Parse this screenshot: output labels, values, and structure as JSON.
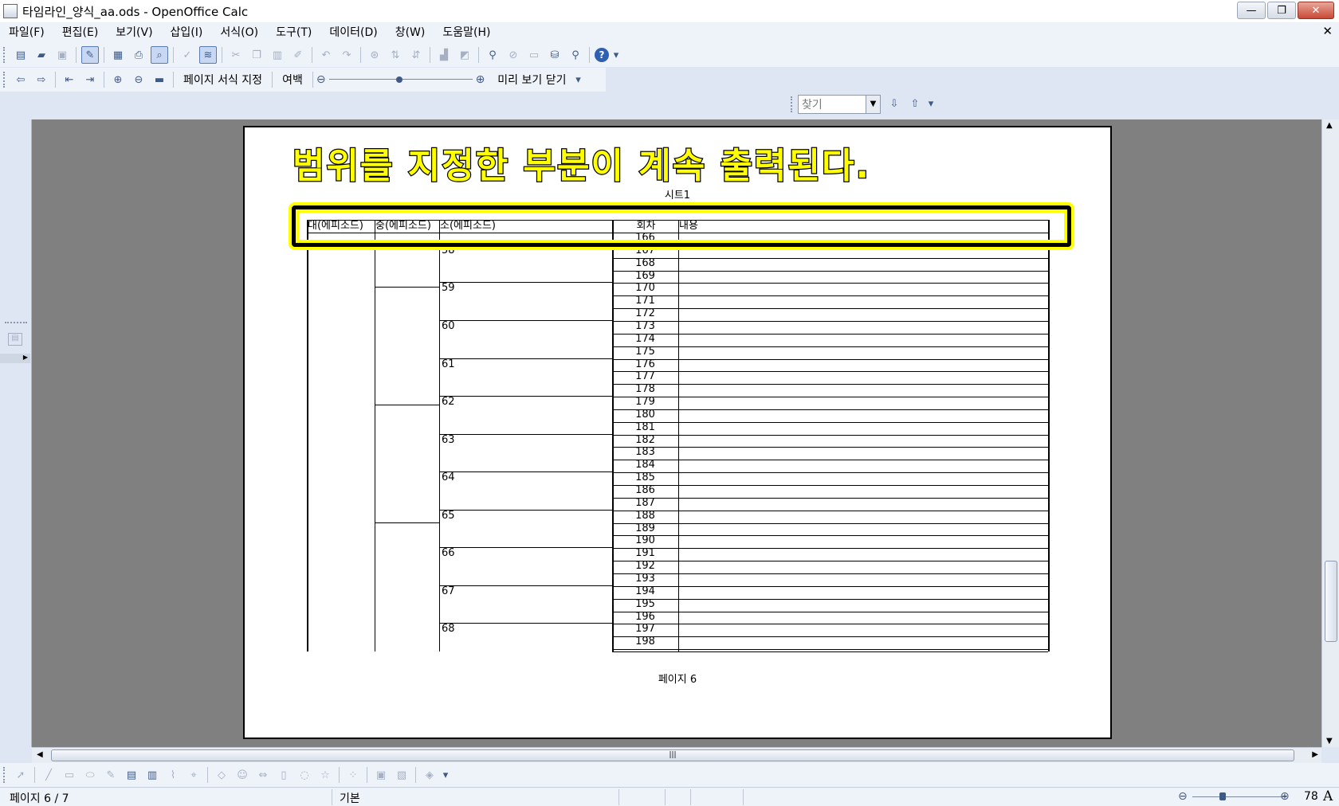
{
  "window": {
    "title": "타임라인_양식_aa.ods - OpenOffice Calc",
    "minimize": "—",
    "restore": "❐",
    "close": "✕"
  },
  "menu": [
    "파일(F)",
    "편집(E)",
    "보기(V)",
    "삽입(I)",
    "서식(O)",
    "도구(T)",
    "데이터(D)",
    "창(W)",
    "도움말(H)"
  ],
  "doc_close": "✕",
  "preview_toolbar": {
    "page_format": "페이지 서식 지정",
    "margins": "여백",
    "close_preview": "미리 보기 닫기",
    "zoom_minus": "⊖",
    "zoom_plus": "⊕"
  },
  "find": {
    "placeholder": "찾기"
  },
  "page": {
    "overlay_text": "범위를 지정한 부분이 계속 출력된다.",
    "sheet_name": "시트1",
    "footer": "페이지 6",
    "headers": [
      "대(에피소드)",
      "중(에피소드)",
      "소(에피소드)",
      "회차",
      "내용"
    ],
    "sub_episodes": [
      "58",
      "59",
      "60",
      "61",
      "62",
      "63",
      "64",
      "65",
      "66",
      "67",
      "68"
    ],
    "episodes": [
      "166",
      "167",
      "168",
      "169",
      "170",
      "171",
      "172",
      "173",
      "174",
      "175",
      "176",
      "177",
      "178",
      "179",
      "180",
      "181",
      "182",
      "183",
      "184",
      "185",
      "186",
      "187",
      "188",
      "189",
      "190",
      "191",
      "192",
      "193",
      "194",
      "195",
      "196",
      "197",
      "198"
    ]
  },
  "status": {
    "page": "페이지 6 / 7",
    "style": "기본",
    "zoom": "78"
  },
  "colors": {
    "highlight": "#ffff00",
    "chrome": "#dfe6f3",
    "workspace": "#808080"
  }
}
